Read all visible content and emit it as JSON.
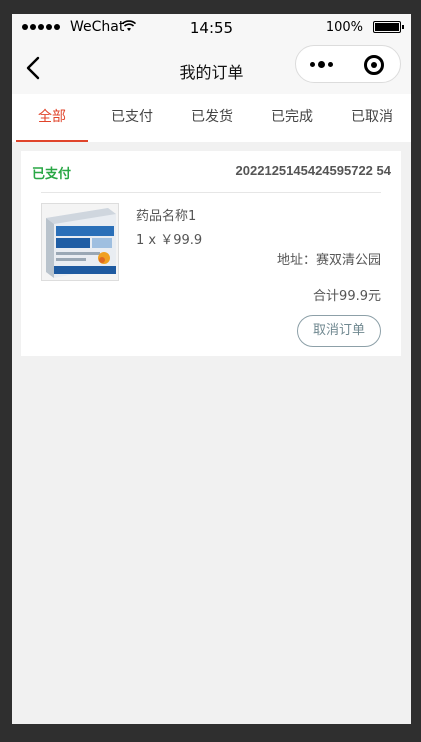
{
  "status_bar": {
    "carrier": "WeChat",
    "time": "14:55",
    "battery": "100%"
  },
  "nav": {
    "title": "我的订单"
  },
  "tabs": [
    {
      "label": "全部",
      "active": true
    },
    {
      "label": "已支付",
      "active": false
    },
    {
      "label": "已发货",
      "active": false
    },
    {
      "label": "已完成",
      "active": false
    },
    {
      "label": "已取消",
      "active": false
    }
  ],
  "order": {
    "status": "已支付",
    "order_no": "2022125145424595722 54",
    "product_name": "药品名称1",
    "product_price": "1 x ￥99.9",
    "address_label": "地址：",
    "address": "赛双清公园",
    "total": "合计99.9元",
    "cancel_label": "取消订单"
  },
  "colors": {
    "accent": "#e0442b",
    "status_green": "#29a745",
    "button_border": "#8da0a8"
  }
}
